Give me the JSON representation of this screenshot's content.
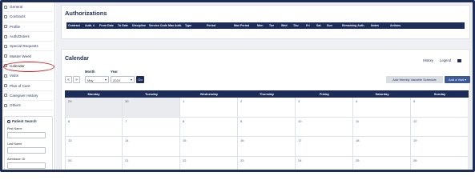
{
  "sidebar": {
    "items": [
      {
        "label": "General",
        "icon": "general-icon"
      },
      {
        "label": "Contracts",
        "icon": "contracts-icon"
      },
      {
        "label": "Profile",
        "icon": "profile-icon"
      },
      {
        "label": "Auth/Orders",
        "icon": "auth-orders-icon"
      },
      {
        "label": "Special Requests",
        "icon": "special-requests-icon"
      },
      {
        "label": "Master Week",
        "icon": "master-week-icon"
      },
      {
        "label": "Calendar",
        "icon": "calendar-icon"
      },
      {
        "label": "Visits",
        "icon": "visits-icon"
      },
      {
        "label": "Plan of Care",
        "icon": "plan-of-care-icon"
      },
      {
        "label": "Caregiver History",
        "icon": "caregiver-history-icon"
      },
      {
        "label": "Others",
        "icon": "others-icon"
      }
    ],
    "active_index": 6,
    "highlight_color": "#d42020"
  },
  "patient_search": {
    "title": "Patient Search",
    "first_name_label": "First Name",
    "last_name_label": "Last Name",
    "admission_label": "Admission ID"
  },
  "authorizations": {
    "title": "Authorizations",
    "columns": [
      "Contract",
      "Auth. #",
      "From Date",
      "To Date",
      "Discipline",
      "Service Code",
      "Max Auth.",
      "Type",
      "Period",
      "Max Period",
      "Mon",
      "Tue",
      "Wed",
      "Thu",
      "Fri",
      "Sat",
      "Sun",
      "Remaining Auth.",
      "Notes",
      "Actions"
    ]
  },
  "calendar": {
    "title": "Calendar",
    "links": {
      "history": "History",
      "legend": "Legend"
    },
    "month_label": "Month",
    "year_label": "Year",
    "month_value": "May",
    "year_value": "2024",
    "prev_label": "«",
    "next_label": "»",
    "go_label": "Go",
    "weekly_variable_label": "Add Weekly Variable Schedule",
    "add_visit_label": "Add a Visit ▾",
    "weekdays": [
      "Monday",
      "Tuesday",
      "Wednesday",
      "Thursday",
      "Friday",
      "Saturday",
      "Sunday"
    ],
    "weeks": [
      [
        {
          "d": "29",
          "out": true
        },
        {
          "d": "30",
          "out": true
        },
        {
          "d": "1"
        },
        {
          "d": "2"
        },
        {
          "d": "3"
        },
        {
          "d": "4"
        },
        {
          "d": "5"
        }
      ],
      [
        {
          "d": "6"
        },
        {
          "d": "7"
        },
        {
          "d": "8"
        },
        {
          "d": "9"
        },
        {
          "d": "10"
        },
        {
          "d": "11"
        },
        {
          "d": "12"
        }
      ],
      [
        {
          "d": "13"
        },
        {
          "d": "14"
        },
        {
          "d": "15"
        },
        {
          "d": "16"
        },
        {
          "d": "17"
        },
        {
          "d": "18"
        },
        {
          "d": "19"
        }
      ],
      [
        {
          "d": "20"
        },
        {
          "d": "21"
        },
        {
          "d": "22"
        },
        {
          "d": "23"
        },
        {
          "d": "24"
        },
        {
          "d": "25"
        },
        {
          "d": "26"
        }
      ]
    ]
  },
  "colors": {
    "primary": "#1c2d5a",
    "accent": "#3c5a9a",
    "background": "#eef0f4"
  }
}
